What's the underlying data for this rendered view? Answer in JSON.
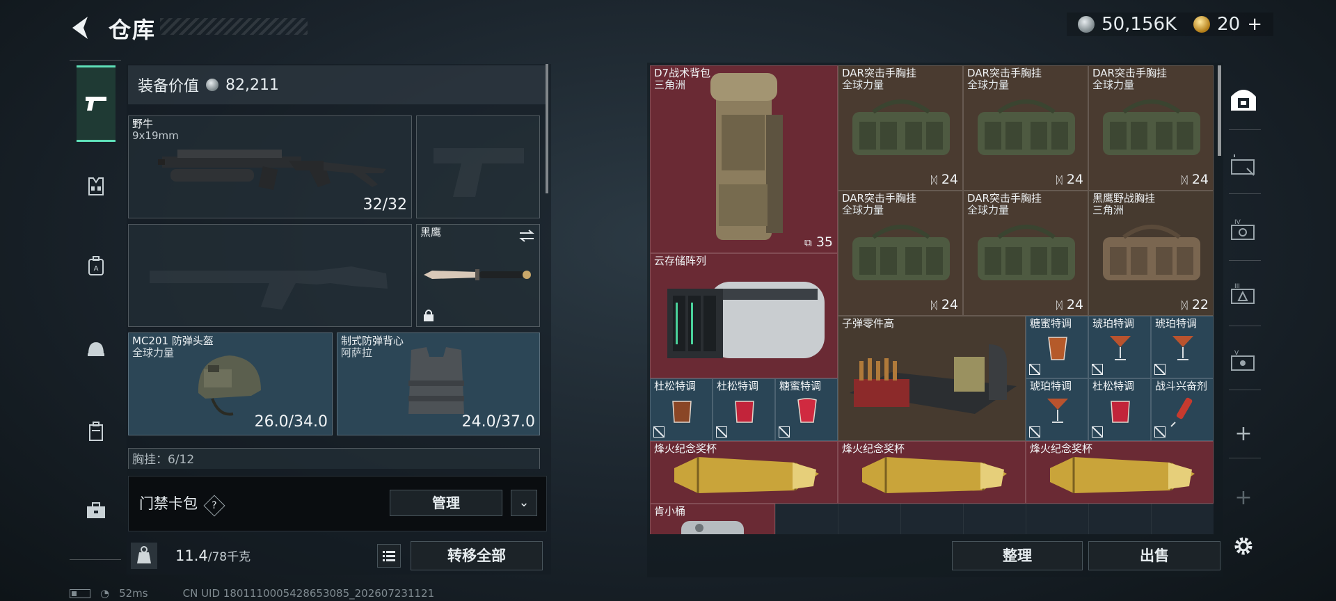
{
  "header": {
    "title": "仓库",
    "currency_silver": "50,156K",
    "currency_gold": "20",
    "currency_gold_plus": "+"
  },
  "left_panel": {
    "equip_value_label": "装备价值",
    "equip_value": "82,211",
    "primary_weapon": {
      "name": "野牛",
      "caliber": "9x19mm",
      "ammo": "32/32"
    },
    "melee": {
      "name": "黑鹰"
    },
    "helmet": {
      "name": "MC201 防弹头盔",
      "faction": "全球力量",
      "durability": "26.0/34.0"
    },
    "armor": {
      "name": "制式防弹背心",
      "faction": "阿萨拉",
      "durability": "24.0/37.0"
    },
    "chest_rig_label": "胸挂：6/12",
    "keycard": {
      "label": "门禁卡包",
      "help": "?",
      "manage": "管理",
      "dropdown": "⌄"
    },
    "weight": {
      "current": "11.4",
      "capacity": "/78千克"
    },
    "transfer_all": "转移全部"
  },
  "stash": {
    "items": [
      {
        "name": "D7战术背包",
        "sub": "三角洲",
        "count": "35"
      },
      {
        "name": "DAR突击手胸挂",
        "sub": "全球力量",
        "count": "24"
      },
      {
        "name": "DAR突击手胸挂",
        "sub": "全球力量",
        "count": "24"
      },
      {
        "name": "DAR突击手胸挂",
        "sub": "全球力量",
        "count": "24"
      },
      {
        "name": "DAR突击手胸挂",
        "sub": "全球力量",
        "count": "24"
      },
      {
        "name": "DAR突击手胸挂",
        "sub": "全球力量",
        "count": "24"
      },
      {
        "name": "黑鹰野战胸挂",
        "sub": "三角洲",
        "count": "22"
      },
      {
        "name": "云存储阵列"
      },
      {
        "name": "子弹零件高"
      },
      {
        "name": "糖蜜特调"
      },
      {
        "name": "琥珀特调"
      },
      {
        "name": "琥珀特调"
      },
      {
        "name": "杜松特调"
      },
      {
        "name": "杜松特调"
      },
      {
        "name": "糖蜜特调"
      },
      {
        "name": "琥珀特调"
      },
      {
        "name": "杜松特调"
      },
      {
        "name": "战斗兴奋剂"
      },
      {
        "name": "烽火纪念奖杯"
      },
      {
        "name": "烽火纪念奖杯"
      },
      {
        "name": "烽火纪念奖杯"
      },
      {
        "name": "肯小桶"
      }
    ],
    "sort": "整理",
    "sell": "出售"
  },
  "status_bar": {
    "ping": "52ms",
    "uid": "CN UID 1801110005428653085_202607231121"
  },
  "colors": {
    "accent": "#5fe0b9",
    "item_red": "#6a2a34",
    "item_brown": "#4a3b30",
    "item_blue": "#2a4556",
    "slot_blue": "#2c4656"
  },
  "icons": {
    "back": "chevron-left-icon",
    "nav": [
      "pistol-icon",
      "vest-icon",
      "backpack-a-icon",
      "helmet-icon",
      "case-icon",
      "briefcase-icon"
    ],
    "right_nav": [
      "safe-icon",
      "tab-i-icon",
      "tab-iv-icon",
      "tab-iii-icon",
      "tab-v-icon",
      "plus-icon",
      "plus-icon",
      "gear-icon"
    ]
  }
}
